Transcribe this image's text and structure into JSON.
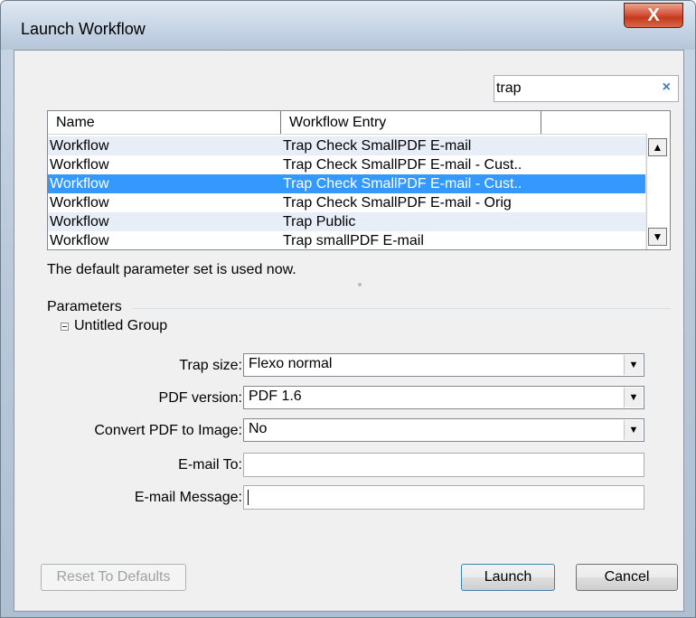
{
  "window": {
    "title": "Launch Workflow",
    "close_label": "X"
  },
  "search": {
    "value": "trap",
    "clear_label": "×"
  },
  "table": {
    "columns": [
      "Name",
      "Workflow Entry",
      ""
    ],
    "rows": [
      {
        "name": "Workflow",
        "entry": "Trap Check SmallPDF E-mail",
        "state": "alt"
      },
      {
        "name": "Workflow",
        "entry": "Trap Check SmallPDF E-mail - Cust..",
        "state": "normal"
      },
      {
        "name": "Workflow",
        "entry": "Trap Check SmallPDF E-mail - Cust..",
        "state": "selected"
      },
      {
        "name": "Workflow",
        "entry": "Trap Check SmallPDF E-mail - Orig",
        "state": "normal"
      },
      {
        "name": "Workflow",
        "entry": "Trap Public",
        "state": "alt"
      },
      {
        "name": "Workflow",
        "entry": "Trap smallPDF E-mail",
        "state": "normal"
      }
    ]
  },
  "status_text": "The default parameter set is used now.",
  "parameters": {
    "section_label": "Parameters",
    "group_label": "Untitled Group",
    "fields": [
      {
        "label": "Trap size:",
        "type": "select",
        "value": "Flexo normal"
      },
      {
        "label": "PDF version:",
        "type": "select",
        "value": "PDF 1.6"
      },
      {
        "label": "Convert PDF to Image:",
        "type": "select",
        "value": "No"
      },
      {
        "label": "E-mail To:",
        "type": "text",
        "value": ""
      },
      {
        "label": "E-mail Message:",
        "type": "text",
        "value": ""
      }
    ]
  },
  "buttons": {
    "reset": "Reset To Defaults",
    "launch": "Launch",
    "cancel": "Cancel"
  },
  "colors": {
    "selection": "#3399ff",
    "alt_row": "#e8eef7",
    "close_button": "#c53a1c"
  }
}
